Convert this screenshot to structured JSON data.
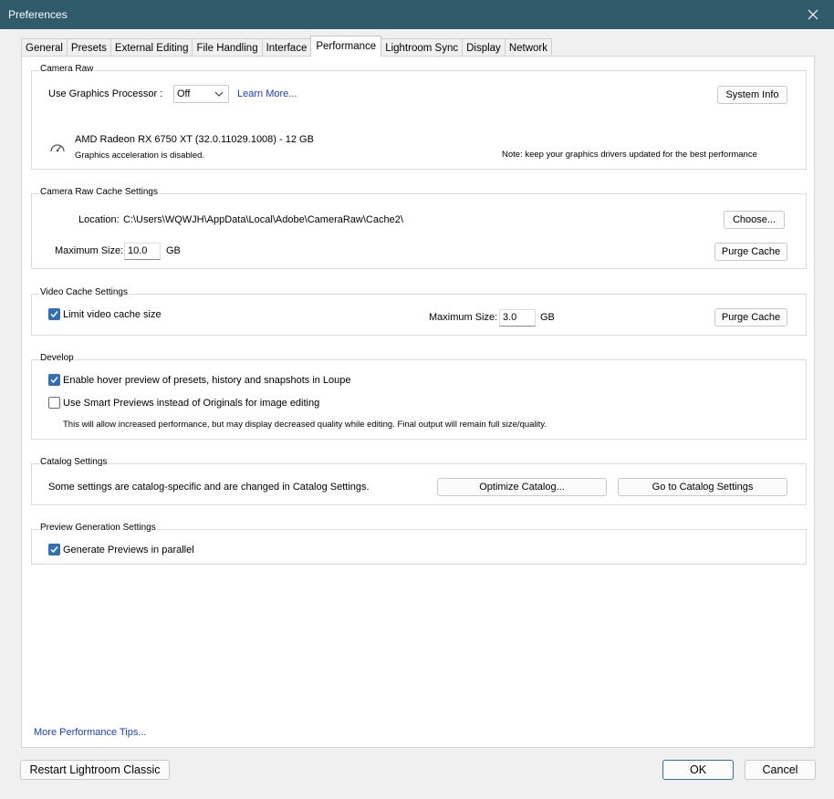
{
  "window": {
    "title": "Preferences"
  },
  "tabs": [
    {
      "label": "General",
      "active": false
    },
    {
      "label": "Presets",
      "active": false
    },
    {
      "label": "External Editing",
      "active": false
    },
    {
      "label": "File Handling",
      "active": false
    },
    {
      "label": "Interface",
      "active": false
    },
    {
      "label": "Performance",
      "active": true
    },
    {
      "label": "Lightroom Sync",
      "active": false
    },
    {
      "label": "Display",
      "active": false
    },
    {
      "label": "Network",
      "active": false
    }
  ],
  "camera_raw": {
    "group_label": "Camera Raw",
    "gpu_label": "Use Graphics Processor :",
    "gpu_value": "Off",
    "learn_more": "Learn More...",
    "system_info": "System Info",
    "gpu_name": "AMD Radeon RX 6750 XT (32.0.11029.1008) - 12 GB",
    "gpu_status": "Graphics acceleration is disabled.",
    "note": "Note: keep your graphics drivers updated for the best performance"
  },
  "cache": {
    "group_label": "Camera Raw Cache Settings",
    "location_label": "Location:",
    "location_path": "C:\\Users\\WQWJH\\AppData\\Local\\Adobe\\CameraRaw\\Cache2\\",
    "choose": "Choose...",
    "max_label": "Maximum Size:",
    "max_value": "10.0",
    "unit": "GB",
    "purge": "Purge Cache"
  },
  "video": {
    "group_label": "Video Cache Settings",
    "limit_label": "Limit video cache size",
    "limit_checked": true,
    "max_label": "Maximum Size:",
    "max_value": "3.0",
    "unit": "GB",
    "purge": "Purge Cache"
  },
  "develop": {
    "group_label": "Develop",
    "hover_label": "Enable hover preview of presets, history and snapshots in Loupe",
    "hover_checked": true,
    "smart_label": "Use Smart Previews instead of Originals for image editing",
    "smart_checked": false,
    "smart_note": "This will allow increased performance, but may display decreased quality while editing. Final output will remain full size/quality."
  },
  "catalog": {
    "group_label": "Catalog Settings",
    "text": "Some settings are catalog-specific and are changed in Catalog Settings.",
    "optimize": "Optimize Catalog...",
    "goto": "Go to Catalog Settings"
  },
  "preview": {
    "group_label": "Preview Generation Settings",
    "parallel_label": "Generate Previews in parallel",
    "parallel_checked": true
  },
  "more_tips": "More Performance Tips...",
  "footer": {
    "restart": "Restart Lightroom Classic",
    "ok": "OK",
    "cancel": "Cancel"
  },
  "colors": {
    "titlebar": "#2f5b6b",
    "accent": "#2f6fb4",
    "link": "#1a3fbf"
  },
  "icons": {
    "close": "close-icon",
    "checkmark": "checkmark-icon",
    "gauge": "gauge-icon",
    "dropdown": "chevron-down-icon"
  }
}
